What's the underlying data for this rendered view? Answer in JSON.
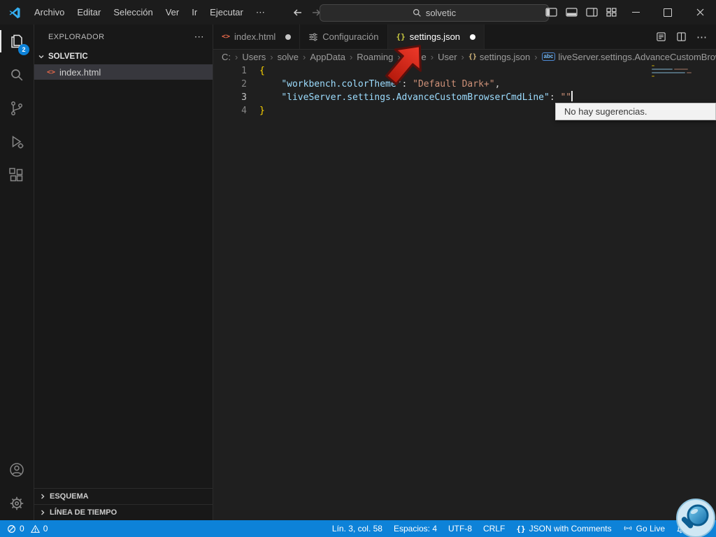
{
  "colors": {
    "status_bar": "#0d82d8",
    "activity_badge": "#0d82d8",
    "syntax_key": "#9cdcfe",
    "syntax_string": "#ce9178",
    "syntax_bracket": "#ffd700",
    "html_icon": "#e8694a",
    "json_icon": "#cbcb41",
    "arrow_annotation": "#d92c1f"
  },
  "title_bar": {
    "menus": [
      {
        "label": "Archivo"
      },
      {
        "label": "Editar"
      },
      {
        "label": "Selección"
      },
      {
        "label": "Ver"
      },
      {
        "label": "Ir"
      },
      {
        "label": "Ejecutar"
      },
      {
        "label": "⋯"
      }
    ],
    "search": {
      "value": "solvetic"
    }
  },
  "activity_bar": {
    "explorer_badge": "2"
  },
  "explorer": {
    "title": "EXPLORADOR",
    "more": "⋯",
    "section": "SOLVETIC",
    "file": "index.html",
    "outline": "ESQUEMA",
    "timeline": "LÍNEA DE TIEMPO"
  },
  "icons": {
    "json": "{}",
    "html": "<>",
    "string_symbol": "abc"
  },
  "tabs": [
    {
      "label": "index.html",
      "modified": true,
      "active": false
    },
    {
      "label": "Configuración",
      "modified": false,
      "active": false
    },
    {
      "label": "settings.json",
      "modified": true,
      "active": true
    }
  ],
  "editor_actions": {
    "more": "⋯"
  },
  "breadcrumb": {
    "separator": "›",
    "items": [
      "C:",
      "Users",
      "solve",
      "AppData",
      "Roaming",
      "Code",
      "User",
      "settings.json",
      "liveServer.settings.AdvanceCustomBrows"
    ]
  },
  "code": {
    "lines": [
      {
        "num": "1",
        "tokens": [
          "{"
        ]
      },
      {
        "num": "2",
        "tokens": [
          "    ",
          "\"workbench.colorTheme\"",
          ": ",
          "\"Default Dark+\"",
          ","
        ]
      },
      {
        "num": "3",
        "tokens": [
          "    ",
          "\"liveServer.settings.AdvanceCustomBrowserCmdLine\"",
          ": ",
          "\"\""
        ]
      },
      {
        "num": "4",
        "tokens": [
          "}"
        ]
      }
    ]
  },
  "suggest_widget": {
    "message": "No hay sugerencias."
  },
  "status_bar": {
    "errors": "0",
    "warnings": "0",
    "line_col": "Lín. 3, col. 58",
    "indentation": "Espacios: 4",
    "encoding": "UTF-8",
    "eol": "CRLF",
    "language": "JSON with Comments",
    "go_live": "Go Live"
  }
}
